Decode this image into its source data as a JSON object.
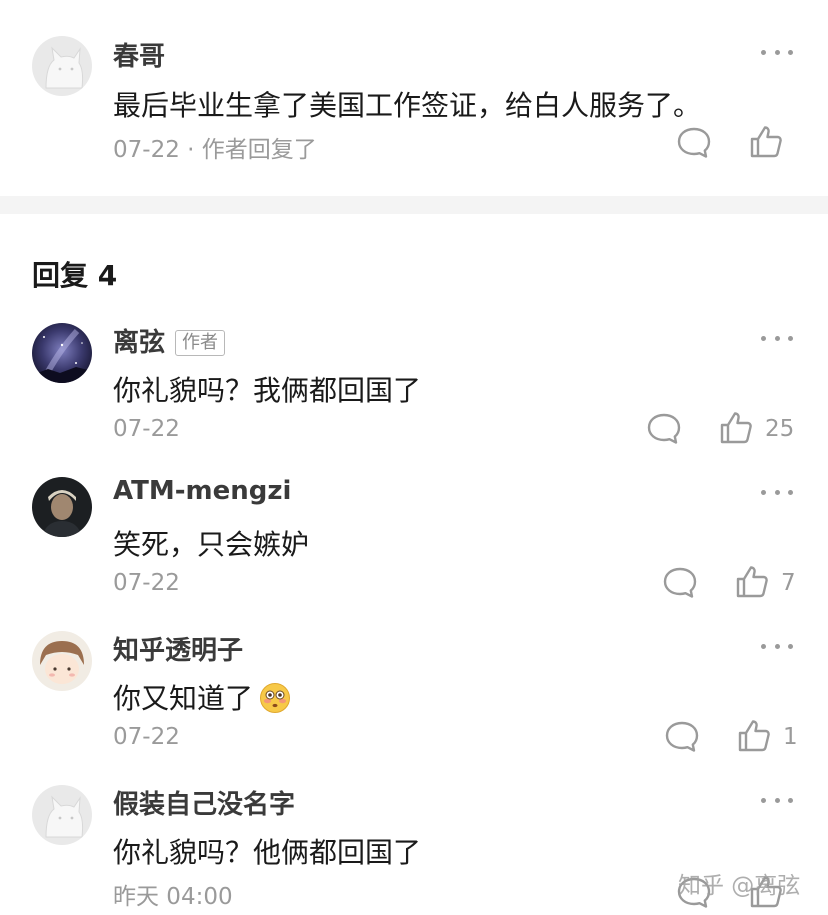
{
  "parent_comment": {
    "author": "春哥",
    "text": "最后毕业生拿了美国工作签证，给白人服务了。",
    "meta": "07-22 · 作者回复了"
  },
  "replies_header": "回复 4",
  "replies": [
    {
      "author": "离弦",
      "author_tag": "作者",
      "text": "你礼貌吗？我俩都回国了",
      "meta": "07-22",
      "likes": "25"
    },
    {
      "author": "ATM-mengzi",
      "text": "笑死，只会嫉妒",
      "meta": "07-22",
      "likes": "7"
    },
    {
      "author": "知乎透明子",
      "text": "你又知道了",
      "meta": "07-22",
      "likes": "1",
      "emoji": "flushed-face-emoji"
    },
    {
      "author": "假装自己没名字",
      "text": "你礼貌吗？他俩都回国了",
      "meta": "昨天 04:00"
    }
  ],
  "watermark": "知乎 @离弦",
  "icons": {
    "comment": "comment-bubble-icon",
    "like": "thumbs-up-icon",
    "more": "more-dots-icon"
  },
  "colors": {
    "text": "#1a1a1a",
    "secondary": "#9a9a9a",
    "divider": "#f4f4f4"
  }
}
